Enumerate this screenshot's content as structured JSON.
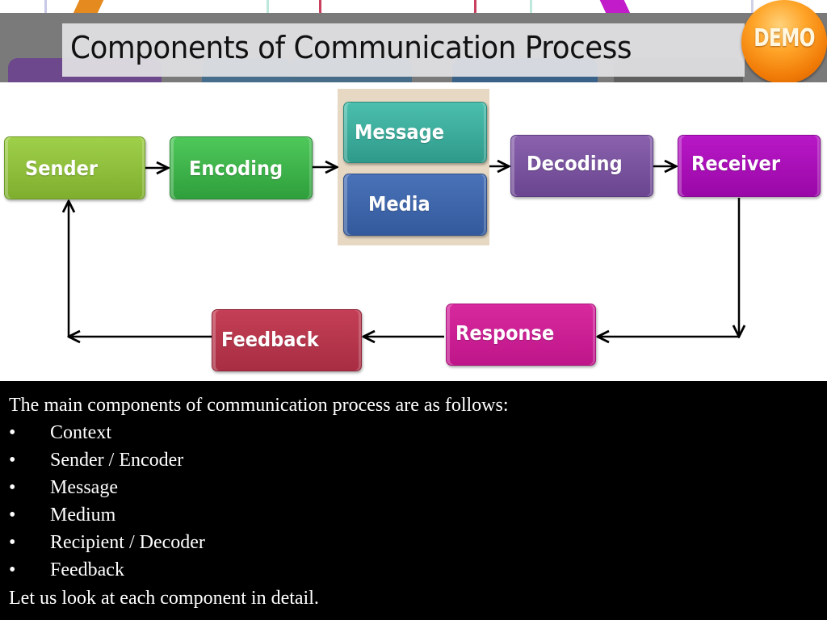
{
  "title": "Components of Communication Process",
  "badge": {
    "label": "DEMO",
    "icon": "demo-badge-icon"
  },
  "diagram": {
    "nodes": {
      "sender": {
        "label": "Sender",
        "color": "#8dbf3a"
      },
      "encoding": {
        "label": "Encoding",
        "color": "#3db54a"
      },
      "message": {
        "label": "Message",
        "color": "#3aab9c"
      },
      "media": {
        "label": "Media",
        "color": "#3d66aa"
      },
      "decoding": {
        "label": "Decoding",
        "color": "#7a529e"
      },
      "receiver": {
        "label": "Receiver",
        "color": "#a910b7"
      },
      "response": {
        "label": "Response",
        "color": "#cc1f94"
      },
      "feedback": {
        "label": "Feedback",
        "color": "#b5364c"
      }
    },
    "flow": [
      [
        "Sender",
        "Encoding"
      ],
      [
        "Encoding",
        "Message/Media"
      ],
      [
        "Message/Media",
        "Decoding"
      ],
      [
        "Decoding",
        "Receiver"
      ],
      [
        "Receiver",
        "Response"
      ],
      [
        "Response",
        "Feedback"
      ],
      [
        "Feedback",
        "Sender"
      ]
    ]
  },
  "text": {
    "intro": "The main components of  communication process are as follows:",
    "bullets": [
      "Context",
      "Sender / Encoder",
      "Message",
      "Medium",
      "Recipient / Decoder",
      "Feedback"
    ],
    "bullet_symbol": "•",
    "outro": "Let us look at each component in detail."
  }
}
